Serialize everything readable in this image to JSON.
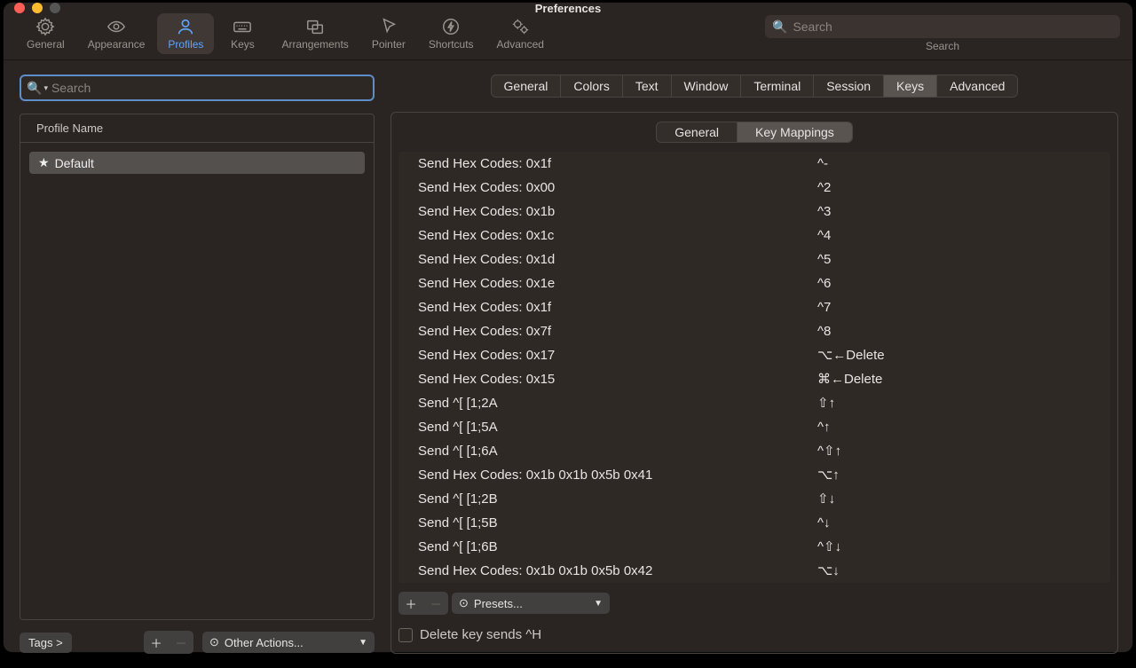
{
  "window": {
    "title": "Preferences"
  },
  "toolbar": {
    "items": [
      {
        "label": "General"
      },
      {
        "label": "Appearance"
      },
      {
        "label": "Profiles"
      },
      {
        "label": "Keys"
      },
      {
        "label": "Arrangements"
      },
      {
        "label": "Pointer"
      },
      {
        "label": "Shortcuts"
      },
      {
        "label": "Advanced"
      }
    ],
    "search_placeholder": "Search",
    "search_label": "Search"
  },
  "profiles": {
    "search_placeholder": "Search",
    "header": "Profile Name",
    "rows": [
      "Default"
    ],
    "tags_label": "Tags >",
    "other_actions_label": "Other Actions..."
  },
  "profile_tabs": [
    "General",
    "Colors",
    "Text",
    "Window",
    "Terminal",
    "Session",
    "Keys",
    "Advanced"
  ],
  "keys_subtabs": [
    "General",
    "Key Mappings"
  ],
  "mappings": [
    {
      "action": "Send Hex Codes: 0x1f",
      "shortcut": "^-"
    },
    {
      "action": "Send Hex Codes: 0x00",
      "shortcut": "^2"
    },
    {
      "action": "Send Hex Codes: 0x1b",
      "shortcut": "^3"
    },
    {
      "action": "Send Hex Codes: 0x1c",
      "shortcut": "^4"
    },
    {
      "action": "Send Hex Codes: 0x1d",
      "shortcut": "^5"
    },
    {
      "action": "Send Hex Codes: 0x1e",
      "shortcut": "^6"
    },
    {
      "action": "Send Hex Codes: 0x1f",
      "shortcut": "^7"
    },
    {
      "action": "Send Hex Codes: 0x7f",
      "shortcut": "^8"
    },
    {
      "action": "Send Hex Codes: 0x17",
      "shortcut": "⌥←Delete"
    },
    {
      "action": "Send Hex Codes: 0x15",
      "shortcut": "⌘←Delete"
    },
    {
      "action": "Send ^[ [1;2A",
      "shortcut": "⇧↑"
    },
    {
      "action": "Send ^[ [1;5A",
      "shortcut": "^↑"
    },
    {
      "action": "Send ^[ [1;6A",
      "shortcut": "^⇧↑"
    },
    {
      "action": "Send Hex Codes: 0x1b 0x1b 0x5b 0x41",
      "shortcut": "⌥↑"
    },
    {
      "action": "Send ^[ [1;2B",
      "shortcut": "⇧↓"
    },
    {
      "action": "Send ^[ [1;5B",
      "shortcut": "^↓"
    },
    {
      "action": "Send ^[ [1;6B",
      "shortcut": "^⇧↓"
    },
    {
      "action": "Send Hex Codes: 0x1b 0x1b 0x5b 0x42",
      "shortcut": "⌥↓"
    }
  ],
  "presets_label": "Presets...",
  "delete_key_label": "Delete key sends ^H"
}
